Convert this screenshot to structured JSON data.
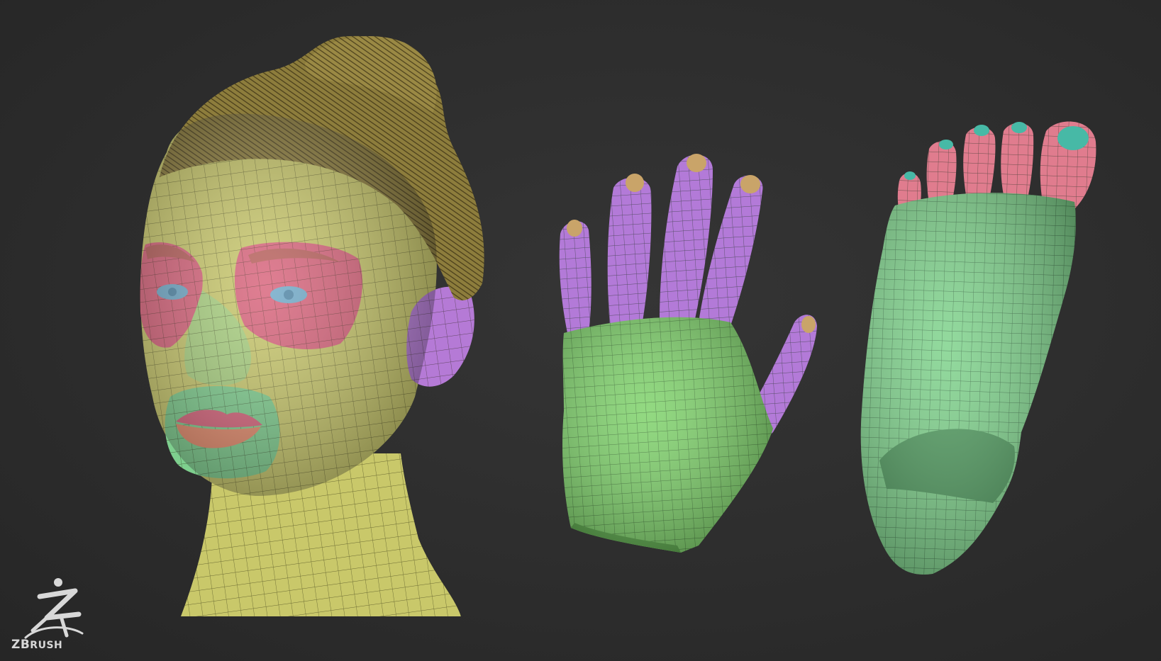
{
  "background_color": "#2d2d2d",
  "logo": {
    "icon": "zbrush-figure-icon",
    "text_main": "ZB",
    "text_rest": "RUSH"
  },
  "models": [
    {
      "name": "head",
      "base_color": "#c9c86a",
      "polygroups": [
        "#d8627a",
        "#7ecf8e",
        "#b57ad6",
        "#e58a6a",
        "#6fa9c8",
        "#8d7d3c"
      ]
    },
    {
      "name": "hand",
      "base_color": "#7fd36b",
      "polygroups": [
        "#b37ad8",
        "#c9a469"
      ]
    },
    {
      "name": "foot",
      "base_color": "#7fd38c",
      "polygroups": [
        "#e07c8e",
        "#47b9a6"
      ]
    }
  ]
}
